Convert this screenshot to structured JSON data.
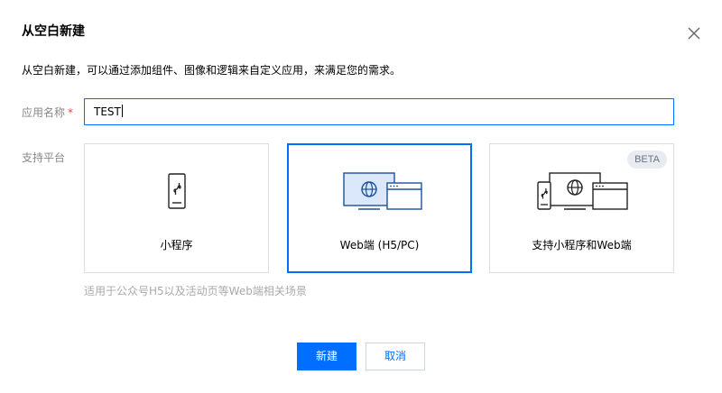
{
  "dialog": {
    "title": "从空白新建",
    "description": "从空白新建，可以通过添加组件、图像和逻辑来自定义应用，来满足您的需求。"
  },
  "form": {
    "app_name_label": "应用名称",
    "required_mark": "*",
    "app_name_value": "TEST",
    "platform_label": "支持平台"
  },
  "platforms": [
    {
      "label": "小程序",
      "icon": "mini-program-icon",
      "selected": false
    },
    {
      "label": "Web端 (H5/PC)",
      "icon": "web-icon",
      "selected": true
    },
    {
      "label": "支持小程序和Web端",
      "icon": "mini-program-and-web-icon",
      "selected": false,
      "badge": "BETA"
    }
  ],
  "hint": "适用于公众号H5以及活动页等Web端相关场景",
  "buttons": {
    "create": "新建",
    "cancel": "取消"
  },
  "colors": {
    "accent": "#006eff",
    "border": "#dddddd",
    "required": "#e54545"
  }
}
